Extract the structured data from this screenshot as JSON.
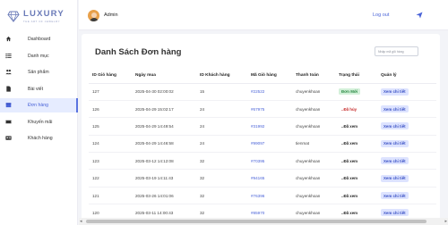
{
  "brand": {
    "name": "LUXURY",
    "tagline": "THE ART OF JEWELRY"
  },
  "sidebar": {
    "items": [
      {
        "label": "Dashboard",
        "icon": "home-icon"
      },
      {
        "label": "Danh mục",
        "icon": "list-icon"
      },
      {
        "label": "Sản phẩm",
        "icon": "people-icon"
      },
      {
        "label": "Bài viết",
        "icon": "file-icon"
      },
      {
        "label": "Đơn hàng",
        "icon": "box-icon",
        "active": true
      },
      {
        "label": "Khuyến mãi",
        "icon": "ticket-icon"
      },
      {
        "label": "Khách hàng",
        "icon": "id-card-icon"
      }
    ]
  },
  "topbar": {
    "admin_name": "Admin",
    "logout_label": "Log out"
  },
  "main": {
    "title": "Danh Sách Đơn hàng",
    "search_placeholder": "Nhập mã giỏ hàng"
  },
  "table": {
    "headers": [
      "ID Giỏ hàng",
      "Ngày mua",
      "ID Khách hàng",
      "Mã Giỏ hàng",
      "Thanh toán",
      "Trạng thái",
      "Quản lý"
    ],
    "rows": [
      {
        "id": "127",
        "date": "2025-04-30 02:00:02",
        "customer": "15",
        "code": "#22522",
        "payment": "chuyenkhoan",
        "status": "Đơn Mới",
        "status_type": "done",
        "action": "Xem chi tiết"
      },
      {
        "id": "126",
        "date": "2025-04-29 15:02:17",
        "customer": "24",
        "code": "#67975",
        "payment": "chuyenkhoan",
        "status": "..Đã hủy",
        "status_type": "cancel",
        "action": "Xem chi tiết"
      },
      {
        "id": "125",
        "date": "2025-04-29 14:49:54",
        "customer": "24",
        "code": "#31992",
        "payment": "chuyenkhoan",
        "status": "..Đã xem",
        "status_type": "seen",
        "action": "Xem chi tiết"
      },
      {
        "id": "124",
        "date": "2025-04-29 14:46:58",
        "customer": "24",
        "code": "#99097",
        "payment": "tienmat",
        "status": "..Đã xem",
        "status_type": "seen",
        "action": "Xem chi tiết"
      },
      {
        "id": "123",
        "date": "2025-03-12 14:12:08",
        "customer": "32",
        "code": "#70395",
        "payment": "chuyenkhoan",
        "status": "..Đã xem",
        "status_type": "seen",
        "action": "Xem chi tiết"
      },
      {
        "id": "122",
        "date": "2025-03-19 14:11:43",
        "customer": "32",
        "code": "#94165",
        "payment": "chuyenkhoan",
        "status": "..Đã xem",
        "status_type": "seen",
        "action": "Xem chi tiết"
      },
      {
        "id": "121",
        "date": "2025-03-26 14:01:06",
        "customer": "32",
        "code": "#76396",
        "payment": "chuyenkhoan",
        "status": "..Đã xem",
        "status_type": "seen",
        "action": "Xem chi tiết"
      },
      {
        "id": "120",
        "date": "2025-03-11 14:00:43",
        "customer": "32",
        "code": "#85970",
        "payment": "chuyenkhoan",
        "status": "..Đã xem",
        "status_type": "seen",
        "action": "Xem chi tiết"
      }
    ]
  },
  "colors": {
    "accent": "#4a63d8",
    "active_bg": "#e6ecff",
    "done_badge": "#d3f0d9",
    "cancel": "#c62828"
  }
}
